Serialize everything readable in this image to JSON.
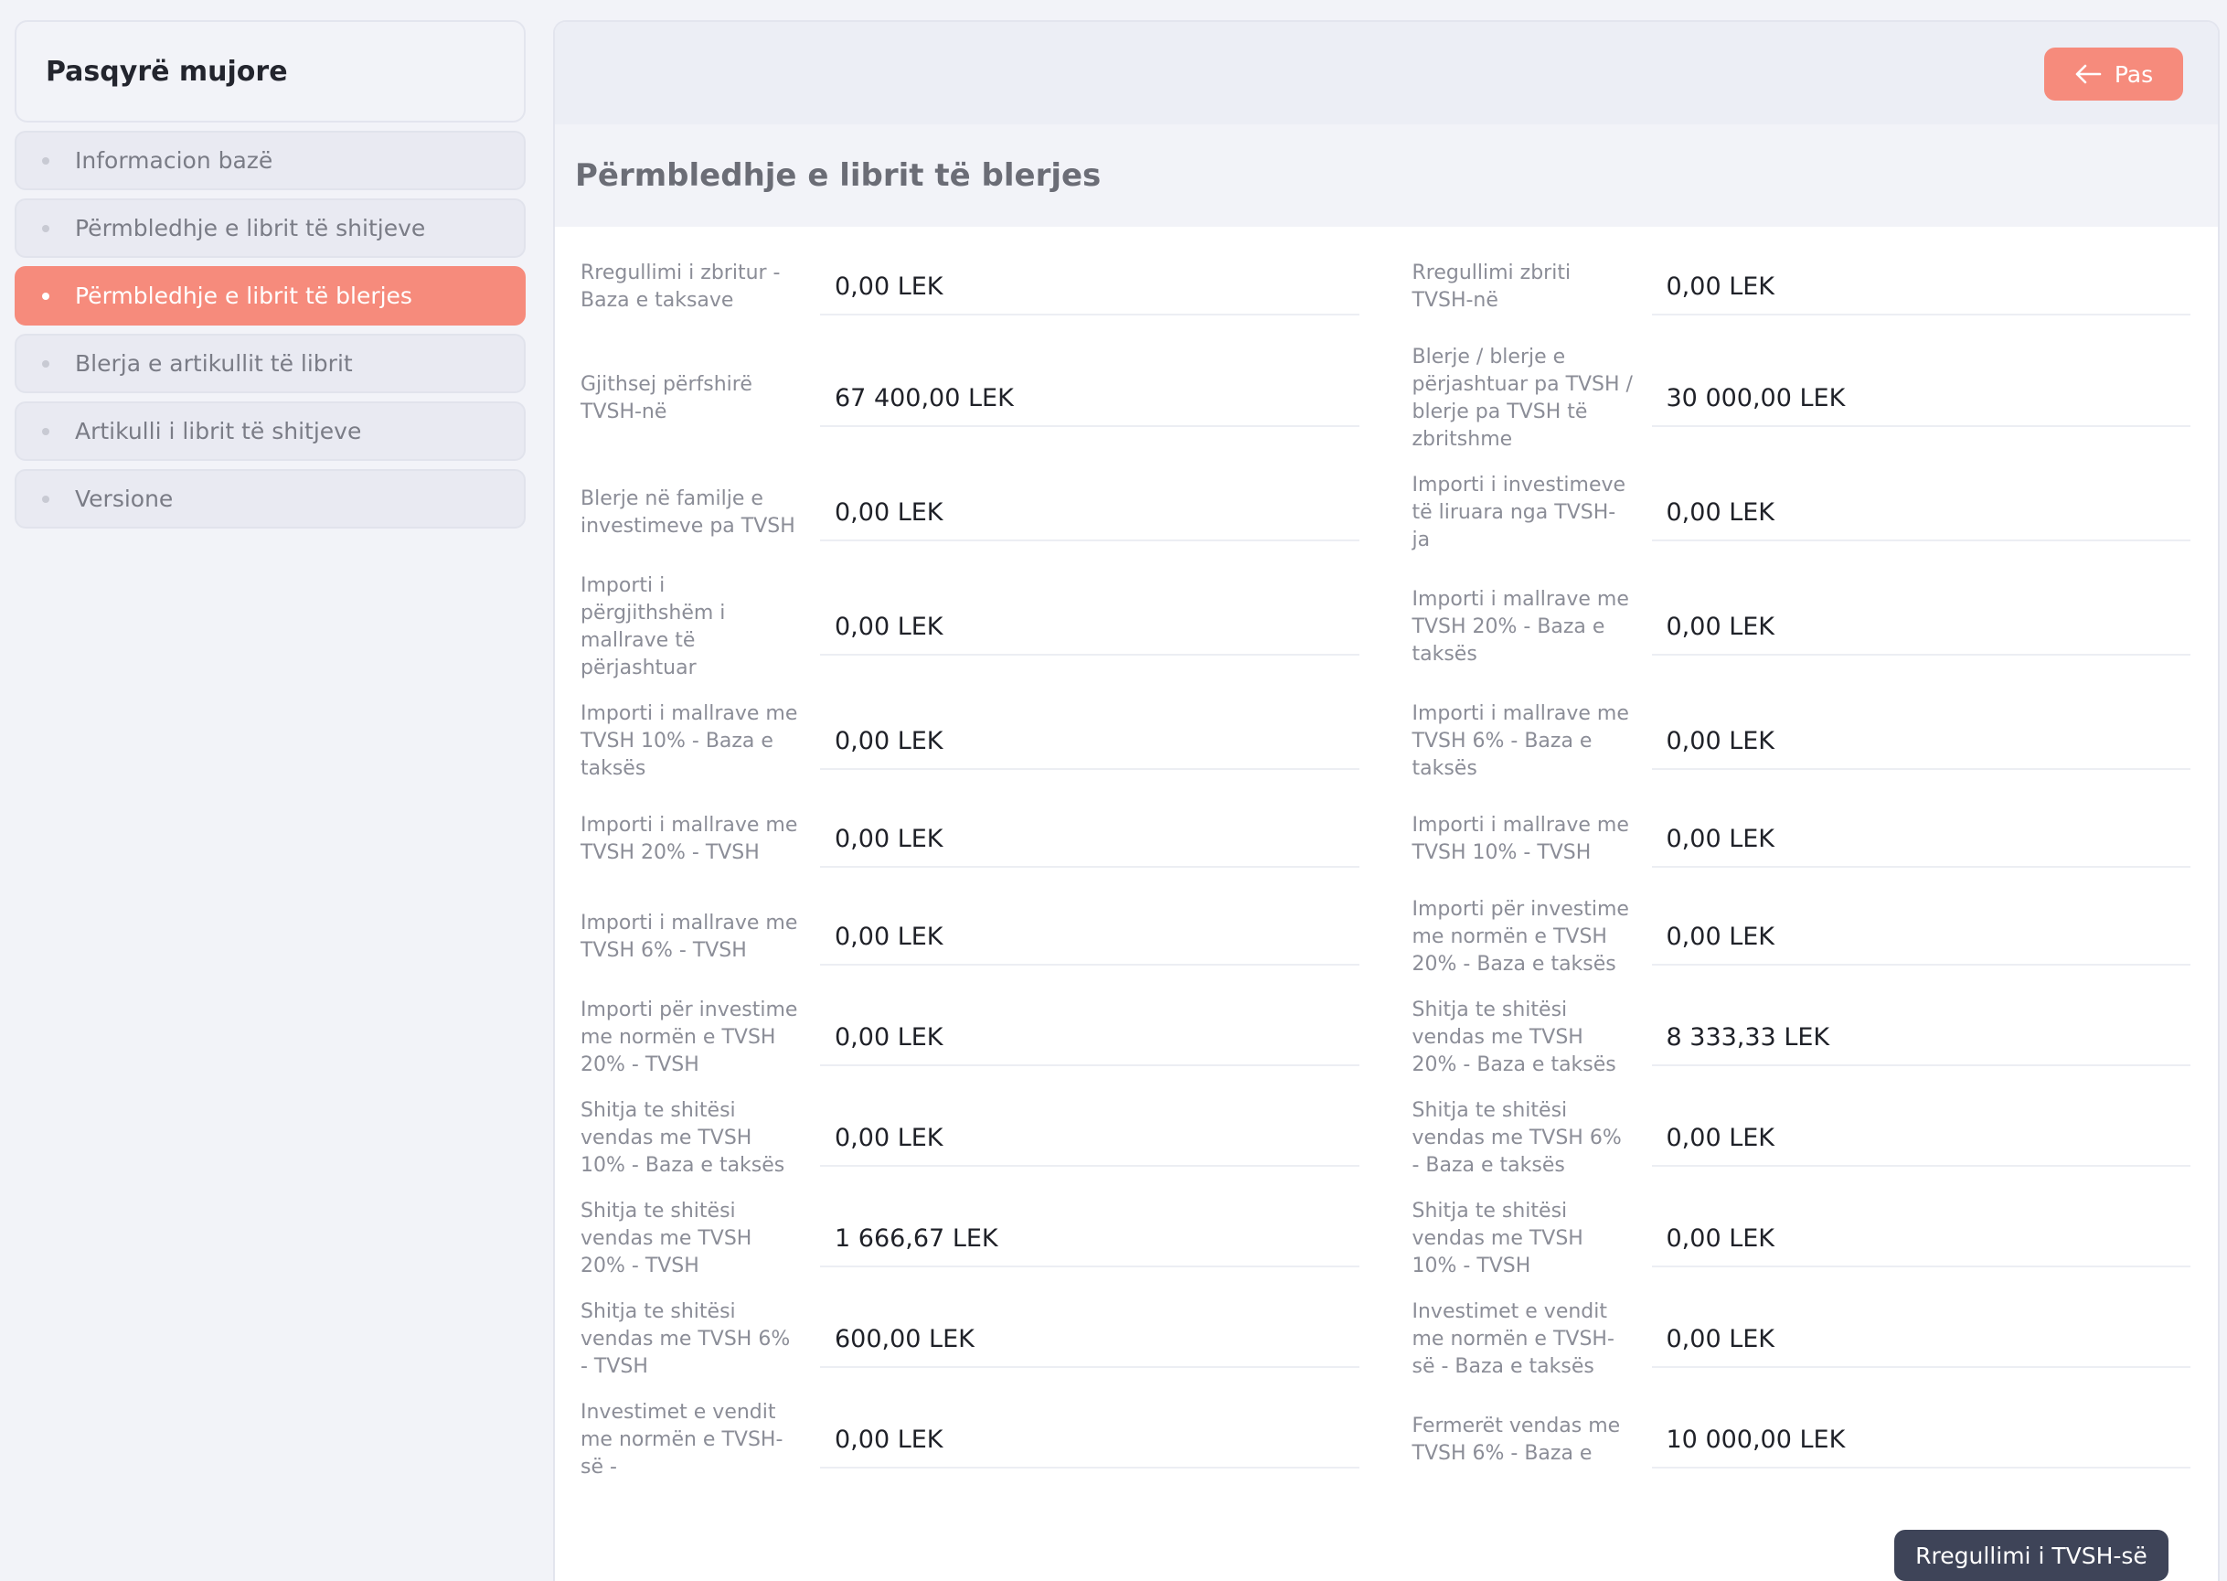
{
  "sidebar": {
    "title": "Pasqyrë mujore",
    "items": [
      {
        "label": "Informacion bazë",
        "active": false
      },
      {
        "label": "Përmbledhje e librit të shitjeve",
        "active": false
      },
      {
        "label": "Përmbledhje e librit të blerjes",
        "active": true
      },
      {
        "label": "Blerja e artikullit të librit",
        "active": false
      },
      {
        "label": "Artikulli i librit të shitjeve",
        "active": false
      },
      {
        "label": "Versione",
        "active": false
      }
    ]
  },
  "header": {
    "back_label": "Pas",
    "back_icon": "arrow-left-icon"
  },
  "page_title": "Përmbledhje e librit të blerjes",
  "fields": [
    {
      "label": "Rregullimi i zbritur - Baza e taksave",
      "value": "0,00 LEK"
    },
    {
      "label": "Rregullimi zbriti TVSH-në",
      "value": "0,00 LEK"
    },
    {
      "label": "Gjithsej përfshirë TVSH-në",
      "value": "67 400,00 LEK"
    },
    {
      "label": "Blerje / blerje e përjashtuar pa TVSH / blerje pa TVSH të zbritshme",
      "value": "30 000,00 LEK"
    },
    {
      "label": "Blerje në familje e investimeve pa TVSH",
      "value": "0,00 LEK"
    },
    {
      "label": "Importi i investimeve të liruara nga TVSH-ja",
      "value": "0,00 LEK"
    },
    {
      "label": "Importi i përgjithshëm i mallrave të përjashtuar",
      "value": "0,00 LEK"
    },
    {
      "label": "Importi i mallrave me TVSH 20% - Baza e taksës",
      "value": "0,00 LEK"
    },
    {
      "label": "Importi i mallrave me TVSH 10% - Baza e taksës",
      "value": "0,00 LEK"
    },
    {
      "label": "Importi i mallrave me TVSH 6% - Baza e taksës",
      "value": "0,00 LEK"
    },
    {
      "label": "Importi i mallrave me TVSH 20% - TVSH",
      "value": "0,00 LEK"
    },
    {
      "label": "Importi i mallrave me TVSH 10% - TVSH",
      "value": "0,00 LEK"
    },
    {
      "label": "Importi i mallrave me TVSH 6% - TVSH",
      "value": "0,00 LEK"
    },
    {
      "label": "Importi për investime me normën e TVSH 20% - Baza e taksës",
      "value": "0,00 LEK"
    },
    {
      "label": "Importi për investime me normën e TVSH 20% - TVSH",
      "value": "0,00 LEK"
    },
    {
      "label": "Shitja te shitësi vendas me TVSH 20% - Baza e taksës",
      "value": "8 333,33 LEK"
    },
    {
      "label": "Shitja te shitësi vendas me TVSH 10% - Baza e taksës",
      "value": "0,00 LEK"
    },
    {
      "label": "Shitja te shitësi vendas me TVSH 6% - Baza e taksës",
      "value": "0,00 LEK"
    },
    {
      "label": "Shitja te shitësi vendas me TVSH 20% - TVSH",
      "value": "1 666,67 LEK"
    },
    {
      "label": "Shitja te shitësi vendas me TVSH 10% - TVSH",
      "value": "0,00 LEK"
    },
    {
      "label": "Shitja te shitësi vendas me TVSH 6% - TVSH",
      "value": "600,00 LEK"
    },
    {
      "label": "Investimet e vendit me normën e TVSH-së - Baza e taksës",
      "value": "0,00 LEK"
    },
    {
      "label": "Investimet e vendit me normën e TVSH-së -",
      "value": "0,00 LEK"
    },
    {
      "label": "Fermerët vendas me TVSH 6% - Baza e",
      "value": "10 000,00 LEK"
    }
  ],
  "footer": {
    "submit_label": "Rregullimi i TVSH-së"
  },
  "colors": {
    "accent": "#f68b7c",
    "dark_button": "#3e4458",
    "background": "#f2f3f8"
  }
}
